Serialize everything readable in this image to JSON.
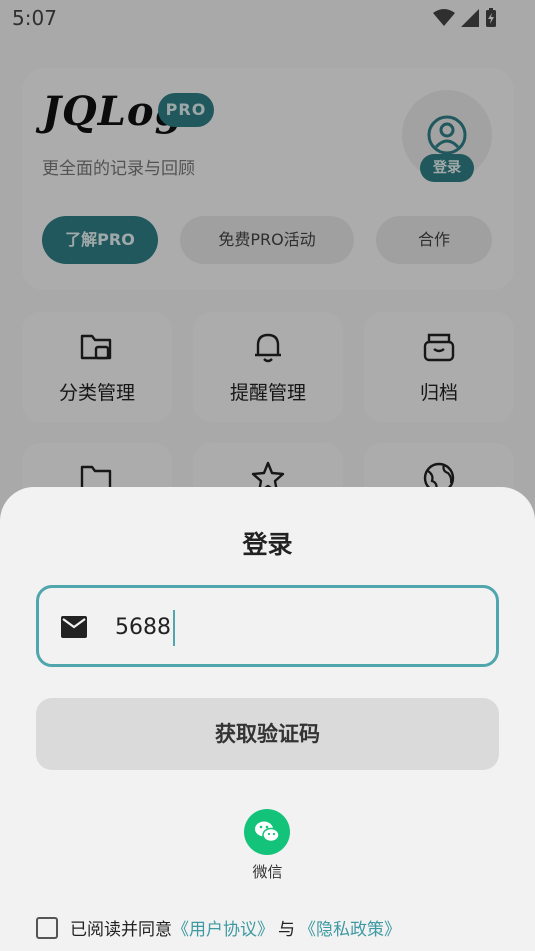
{
  "status_bar": {
    "time": "5:07"
  },
  "header": {
    "logo": "JQLog",
    "pro_badge": "PRO",
    "subtitle": "更全面的记录与回顾",
    "login_chip": "登录",
    "buttons": {
      "learn_pro": "了解PRO",
      "free_pro": "免费PRO活动",
      "cooperate": "合作"
    }
  },
  "tiles": [
    {
      "label": "分类管理",
      "icon": "folder-icon"
    },
    {
      "label": "提醒管理",
      "icon": "bell-icon"
    },
    {
      "label": "归档",
      "icon": "archive-box-icon"
    },
    {
      "label": "",
      "icon": "folder-home-icon"
    },
    {
      "label": "",
      "icon": "star-icon"
    },
    {
      "label": "",
      "icon": "globe-icon"
    }
  ],
  "login_sheet": {
    "title": "登录",
    "email_value": "5688",
    "get_code_button": "获取验证码",
    "wechat_label": "微信",
    "agreement": {
      "prefix": "已阅读并同意",
      "user_agreement": "《用户协议》",
      "and": "与",
      "privacy_policy": "《隐私政策》"
    }
  },
  "colors": {
    "accent": "#2f7f86",
    "link": "#3e9aa2",
    "wechat": "#13c37a"
  }
}
